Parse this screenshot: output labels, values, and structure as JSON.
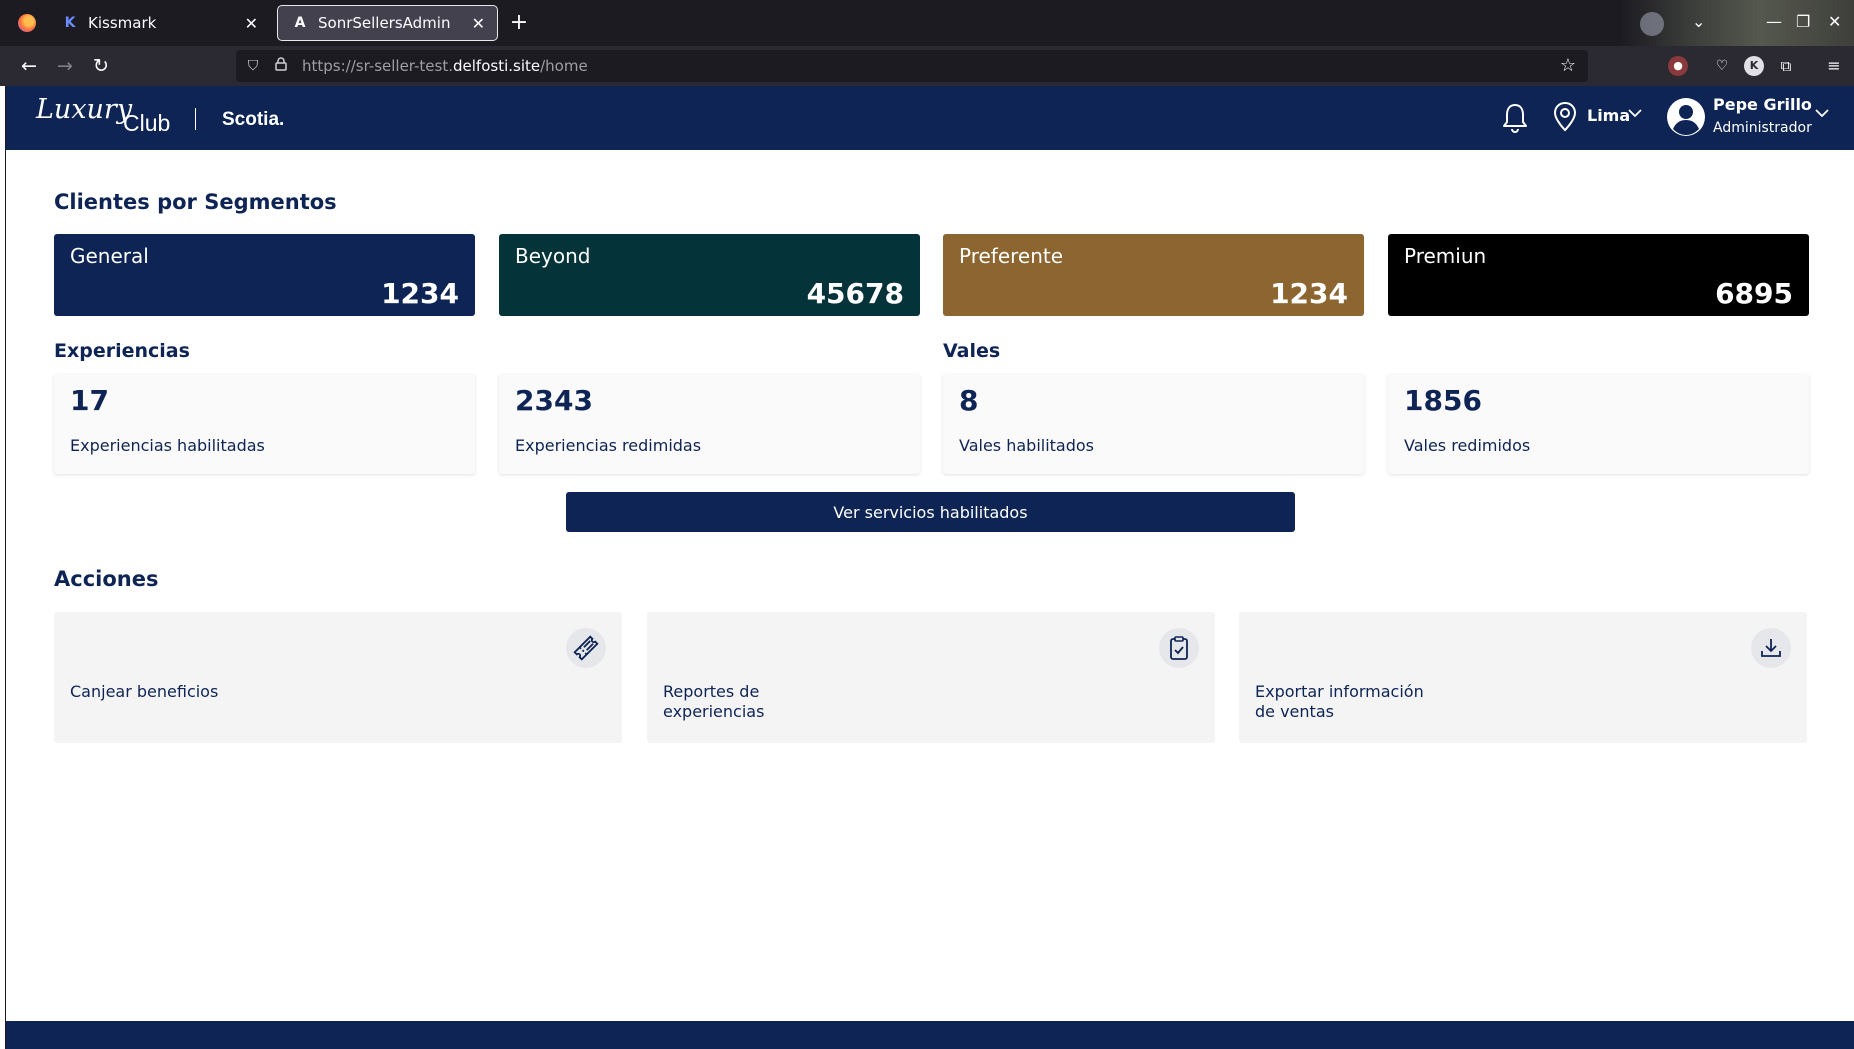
{
  "browser": {
    "tabs": [
      {
        "favicon": "K",
        "title": "Kissmark",
        "active": false
      },
      {
        "favicon": "A",
        "title": "SonrSellersAdmin",
        "active": true
      }
    ],
    "url_prefix": "https://sr-seller-test.",
    "url_domain": "delfosti.site",
    "url_path": "/home"
  },
  "header": {
    "logo_luxury": "Luxury",
    "logo_club": "Club",
    "logo_bank": "Scotia.",
    "location": "Lima",
    "user_name": "Pepe Grillo",
    "user_role": "Administrador"
  },
  "segments": {
    "title": "Clientes por Segmentos",
    "items": [
      {
        "name": "General",
        "value": "1234",
        "color": "#0e2455"
      },
      {
        "name": "Beyond",
        "value": "45678",
        "color": "#04343a"
      },
      {
        "name": "Preferente",
        "value": "1234",
        "color": "#8c6530"
      },
      {
        "name": "Premiun",
        "value": "6895",
        "color": "#000000"
      }
    ]
  },
  "experiencias": {
    "title": "Experiencias",
    "items": [
      {
        "value": "17",
        "label": "Experiencias habilitadas"
      },
      {
        "value": "2343",
        "label": "Experiencias redimidas"
      }
    ]
  },
  "vales": {
    "title": "Vales",
    "items": [
      {
        "value": "8",
        "label": "Vales habilitados"
      },
      {
        "value": "1856",
        "label": "Vales redimidos"
      }
    ]
  },
  "services_button": "Ver servicios habilitados",
  "acciones": {
    "title": "Acciones",
    "items": [
      {
        "label": "Canjear beneficios",
        "icon": "ticket-icon"
      },
      {
        "label": "Reportes de experiencias",
        "icon": "clipboard-check-icon"
      },
      {
        "label": "Exportar información de ventas",
        "icon": "download-icon"
      }
    ]
  },
  "colors": {
    "brand_navy": "#0e2455",
    "card_bg": "#f4f4f5"
  }
}
